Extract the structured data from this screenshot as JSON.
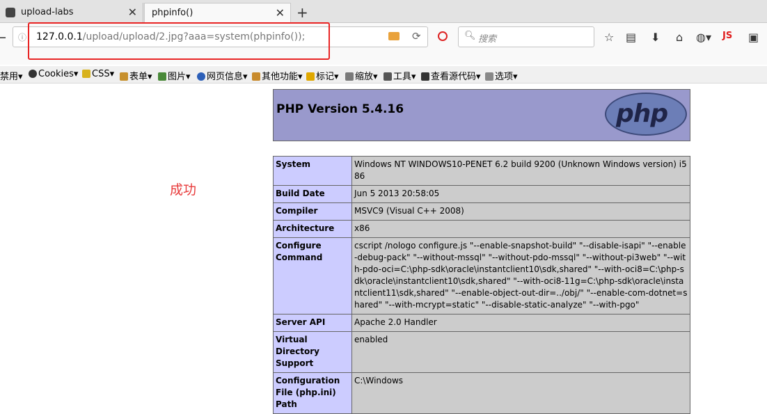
{
  "tabs": [
    {
      "title": "upload-labs"
    },
    {
      "title": "phpinfo()"
    }
  ],
  "url": {
    "host": "127.0.0.1",
    "path": "/upload/upload/2.jpg?aaa=system(phpinfo());"
  },
  "search": {
    "placeholder": "搜索"
  },
  "devbar": {
    "items": [
      "禁用",
      "Cookies",
      "CSS",
      "表单",
      "图片",
      "网页信息",
      "其他功能",
      "标记",
      "缩放",
      "工具",
      "查看源代码",
      "选项"
    ]
  },
  "js_label": "JS",
  "annotation": {
    "text": "成功",
    "color": "#e83b3b"
  },
  "php": {
    "version_title": "PHP Version 5.4.16",
    "logo_text": "php",
    "rows": [
      {
        "key": "System",
        "value": "Windows NT WINDOWS10-PENET 6.2 build 9200 (Unknown Windows version) i586"
      },
      {
        "key": "Build Date",
        "value": "Jun 5 2013 20:58:05"
      },
      {
        "key": "Compiler",
        "value": "MSVC9 (Visual C++ 2008)"
      },
      {
        "key": "Architecture",
        "value": "x86"
      },
      {
        "key": "Configure Command",
        "value": "cscript /nologo configure.js \"--enable-snapshot-build\" \"--disable-isapi\" \"--enable-debug-pack\" \"--without-mssql\" \"--without-pdo-mssql\" \"--without-pi3web\" \"--with-pdo-oci=C:\\php-sdk\\oracle\\instantclient10\\sdk,shared\" \"--with-oci8=C:\\php-sdk\\oracle\\instantclient10\\sdk,shared\" \"--with-oci8-11g=C:\\php-sdk\\oracle\\instantclient11\\sdk,shared\" \"--enable-object-out-dir=../obj/\" \"--enable-com-dotnet=shared\" \"--with-mcrypt=static\" \"--disable-static-analyze\" \"--with-pgo\""
      },
      {
        "key": "Server API",
        "value": "Apache 2.0 Handler"
      },
      {
        "key": "Virtual Directory Support",
        "value": "enabled"
      },
      {
        "key": "Configuration File (php.ini) Path",
        "value": "C:\\Windows"
      }
    ]
  }
}
